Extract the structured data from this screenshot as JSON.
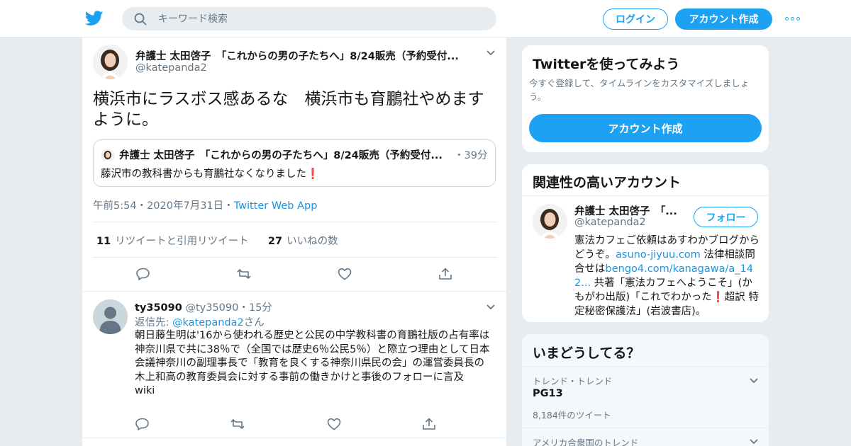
{
  "header": {
    "search_placeholder": "キーワード検索",
    "login_label": "ログイン",
    "signup_label": "アカウント作成"
  },
  "tweet": {
    "fullname": "弁護士 太田啓子　「これからの男の子たちへ」8/24販売（予約受付...",
    "handle": "@katepanda2",
    "text": "横浜市にラスボス感あるな　横浜市も育鵬社やめますように。",
    "quote": {
      "fullname": "弁護士 太田啓子　「これからの男の子たちへ」8/24販売（予約受付...",
      "time": "・39分",
      "text": "藤沢市の教科書からも育鵬社なくなりました",
      "emoji": "❗"
    },
    "timestamp": "午前5:54・2020年7月31日・",
    "source": "Twitter Web App",
    "retweets_count": "11",
    "retweets_label": "リツイートと引用リツイート",
    "likes_count": "27",
    "likes_label": "いいねの数"
  },
  "reply": {
    "name": "ty35090",
    "handle_time": "@ty35090・15分",
    "reply_prefix": "返信先: ",
    "reply_handle": "@katepanda2",
    "reply_suffix": "さん",
    "text_line1": "朝日藤生明は'16から使われる歴史と公民の中学教科書の育鵬社版の占有率は神奈川県で共に38％で（全国では歴史6％公民5％）と際立つ理由として日本会議神奈川の副理事長で「教育を良くする神奈川県民の会」の運営委員長の木上和高の教育委員会に対する事前の働きかけと事後のフォローに言及",
    "text_line2": "wiki"
  },
  "sidebar": {
    "signup_card": {
      "title": "Twitterを使ってみよう",
      "subtitle": "今すぐ登録して、タイムラインをカスタマイズしましょう。",
      "cta": "アカウント作成"
    },
    "related": {
      "title": "関連性の高いアカウント",
      "name": "弁護士 太田啓子　「...",
      "handle": "@katepanda2",
      "follow_label": "フォロー",
      "bio_1": "憲法カフェご依頼はあすわかブログからどうぞ。",
      "bio_link1": "asuno-jiyuu.com",
      "bio_2": " 法律相談問合せは",
      "bio_link2": "bengo4.com/kanagawa/a_142...",
      "bio_3": " 共著「憲法カフェへようこそ」(かもがわ出版)「これでわかった",
      "bio_excl": "❗",
      "bio_4": "超訳 特定秘密保護法」(岩波書店)。"
    },
    "trends": {
      "title": "いまどうしてる？",
      "item1_label": "トレンド・トレンド",
      "item1_name": "PG13",
      "item1_count": "8,184件のツイート",
      "item2_label": "アメリカ合衆国のトレンド"
    }
  },
  "colors": {
    "brand_blue": "#1da1f2",
    "link_blue": "#1b95e0",
    "muted_gray": "#657786",
    "background": "#e6ecf0"
  }
}
